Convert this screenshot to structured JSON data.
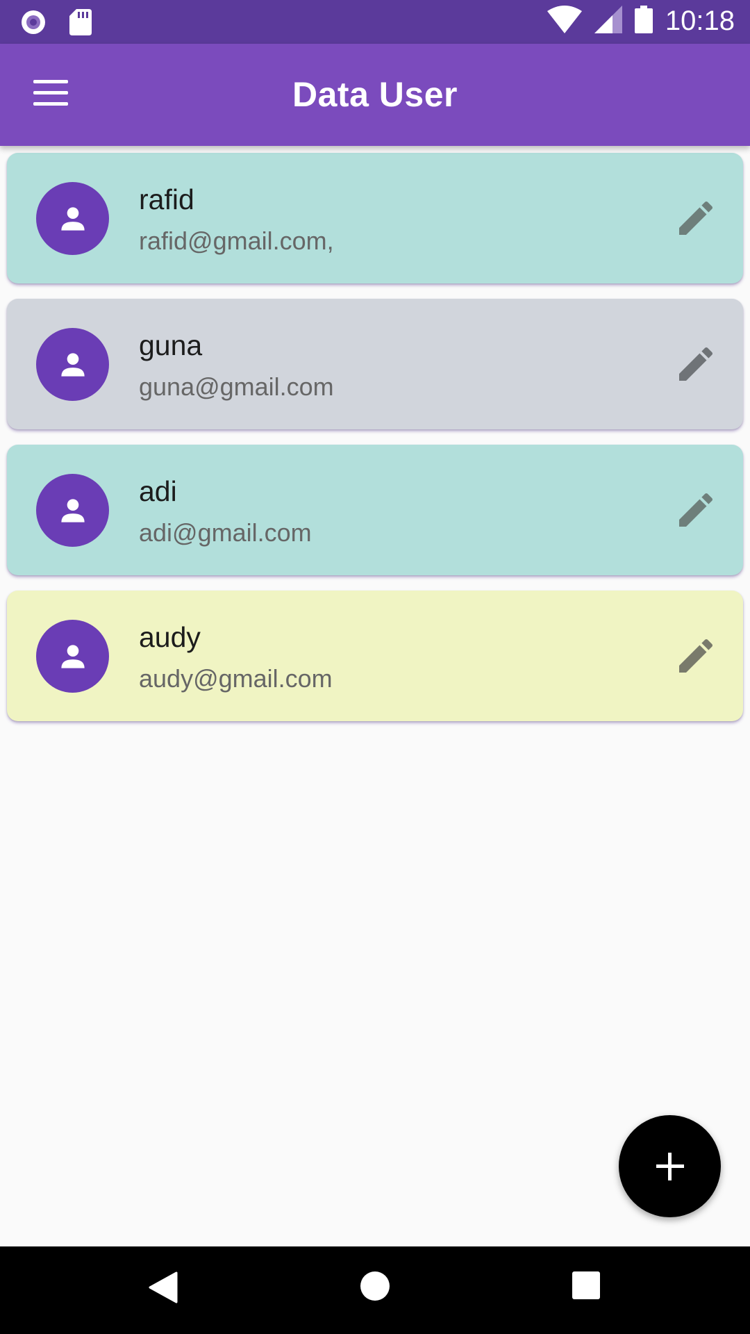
{
  "status_bar": {
    "time": "10:18",
    "left_icons": [
      "record-icon",
      "sd-card-icon"
    ],
    "right_icons": [
      "wifi-icon",
      "signal-icon",
      "battery-icon"
    ]
  },
  "app_bar": {
    "title": "Data User",
    "menu_icon": "menu-icon"
  },
  "users": [
    {
      "name": "rafid",
      "email": "rafid@gmail.com,",
      "color": "#b2dfdb"
    },
    {
      "name": "guna",
      "email": "guna@gmail.com",
      "color": "#d1d5dc"
    },
    {
      "name": "adi",
      "email": "adi@gmail.com",
      "color": "#b2dfdb"
    },
    {
      "name": "audy",
      "email": "audy@gmail.com",
      "color": "#f0f4c3"
    }
  ],
  "colors": {
    "status_bar": "#5b3a9b",
    "app_bar": "#7b4bbd",
    "avatar": "#6a3db5",
    "fab": "#000000"
  },
  "fab": {
    "icon": "add-icon"
  },
  "nav_bar": {
    "icons": [
      "back-icon",
      "home-icon",
      "recents-icon"
    ]
  }
}
